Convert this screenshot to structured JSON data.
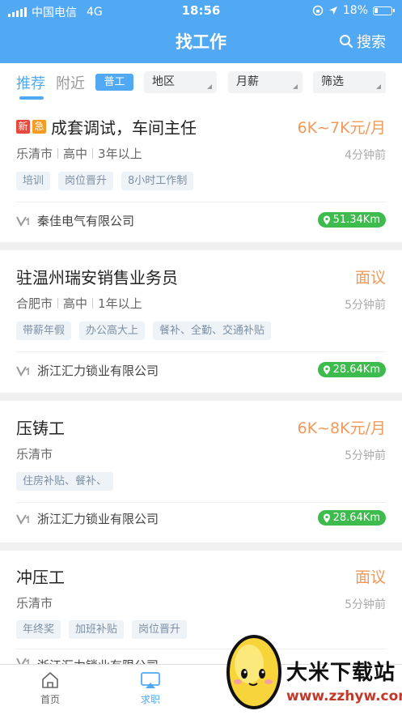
{
  "status": {
    "carrier": "中国电信",
    "network": "4G",
    "time": "18:56",
    "battery": "18%"
  },
  "header": {
    "title": "找工作",
    "search_label": "搜索"
  },
  "filters": {
    "tab_recommend": "推荐",
    "tab_nearby": "附近",
    "chip": "普工",
    "dropdowns": [
      "地区",
      "月薪",
      "筛选"
    ]
  },
  "jobs": [
    {
      "badges": [
        "新",
        "急"
      ],
      "title": "成套调试，车间主任",
      "salary": "6K~7K元/月",
      "city": "乐清市",
      "education": "高中",
      "experience": "3年以上",
      "ago": "4分钟前",
      "tags": [
        "培训",
        "岗位晋升",
        "8小时工作制"
      ],
      "company": "秦佳电气有限公司",
      "distance": "51.34Km"
    },
    {
      "title": "驻温州瑞安销售业务员",
      "salary": "面议",
      "city": "合肥市",
      "education": "高中",
      "experience": "1年以上",
      "ago": "5分钟前",
      "tags": [
        "带薪年假",
        "办公高大上",
        "餐补、全勤、交通补贴"
      ],
      "company": "浙江汇力锁业有限公司",
      "distance": "28.64Km"
    },
    {
      "title": "压铸工",
      "salary": "6K~8K元/月",
      "city": "乐清市",
      "ago": "5分钟前",
      "tags": [
        "住房补贴、餐补、"
      ],
      "company": "浙江汇力锁业有限公司",
      "distance": "28.64Km"
    },
    {
      "title": "冲压工",
      "salary": "面议",
      "city": "乐清市",
      "ago": "5分钟前",
      "tags": [
        "年终奖",
        "加班补贴",
        "岗位晋升"
      ],
      "company": "浙江汇力锁业有限公司"
    }
  ],
  "tabbar": {
    "home": "首页",
    "jobs": "求职"
  },
  "watermark": {
    "name": "大米下载站",
    "url": "www.zzhyw.com"
  },
  "colors": {
    "primary": "#52a9f3",
    "salary": "#f09a5a",
    "distance": "#3dbb4c"
  }
}
